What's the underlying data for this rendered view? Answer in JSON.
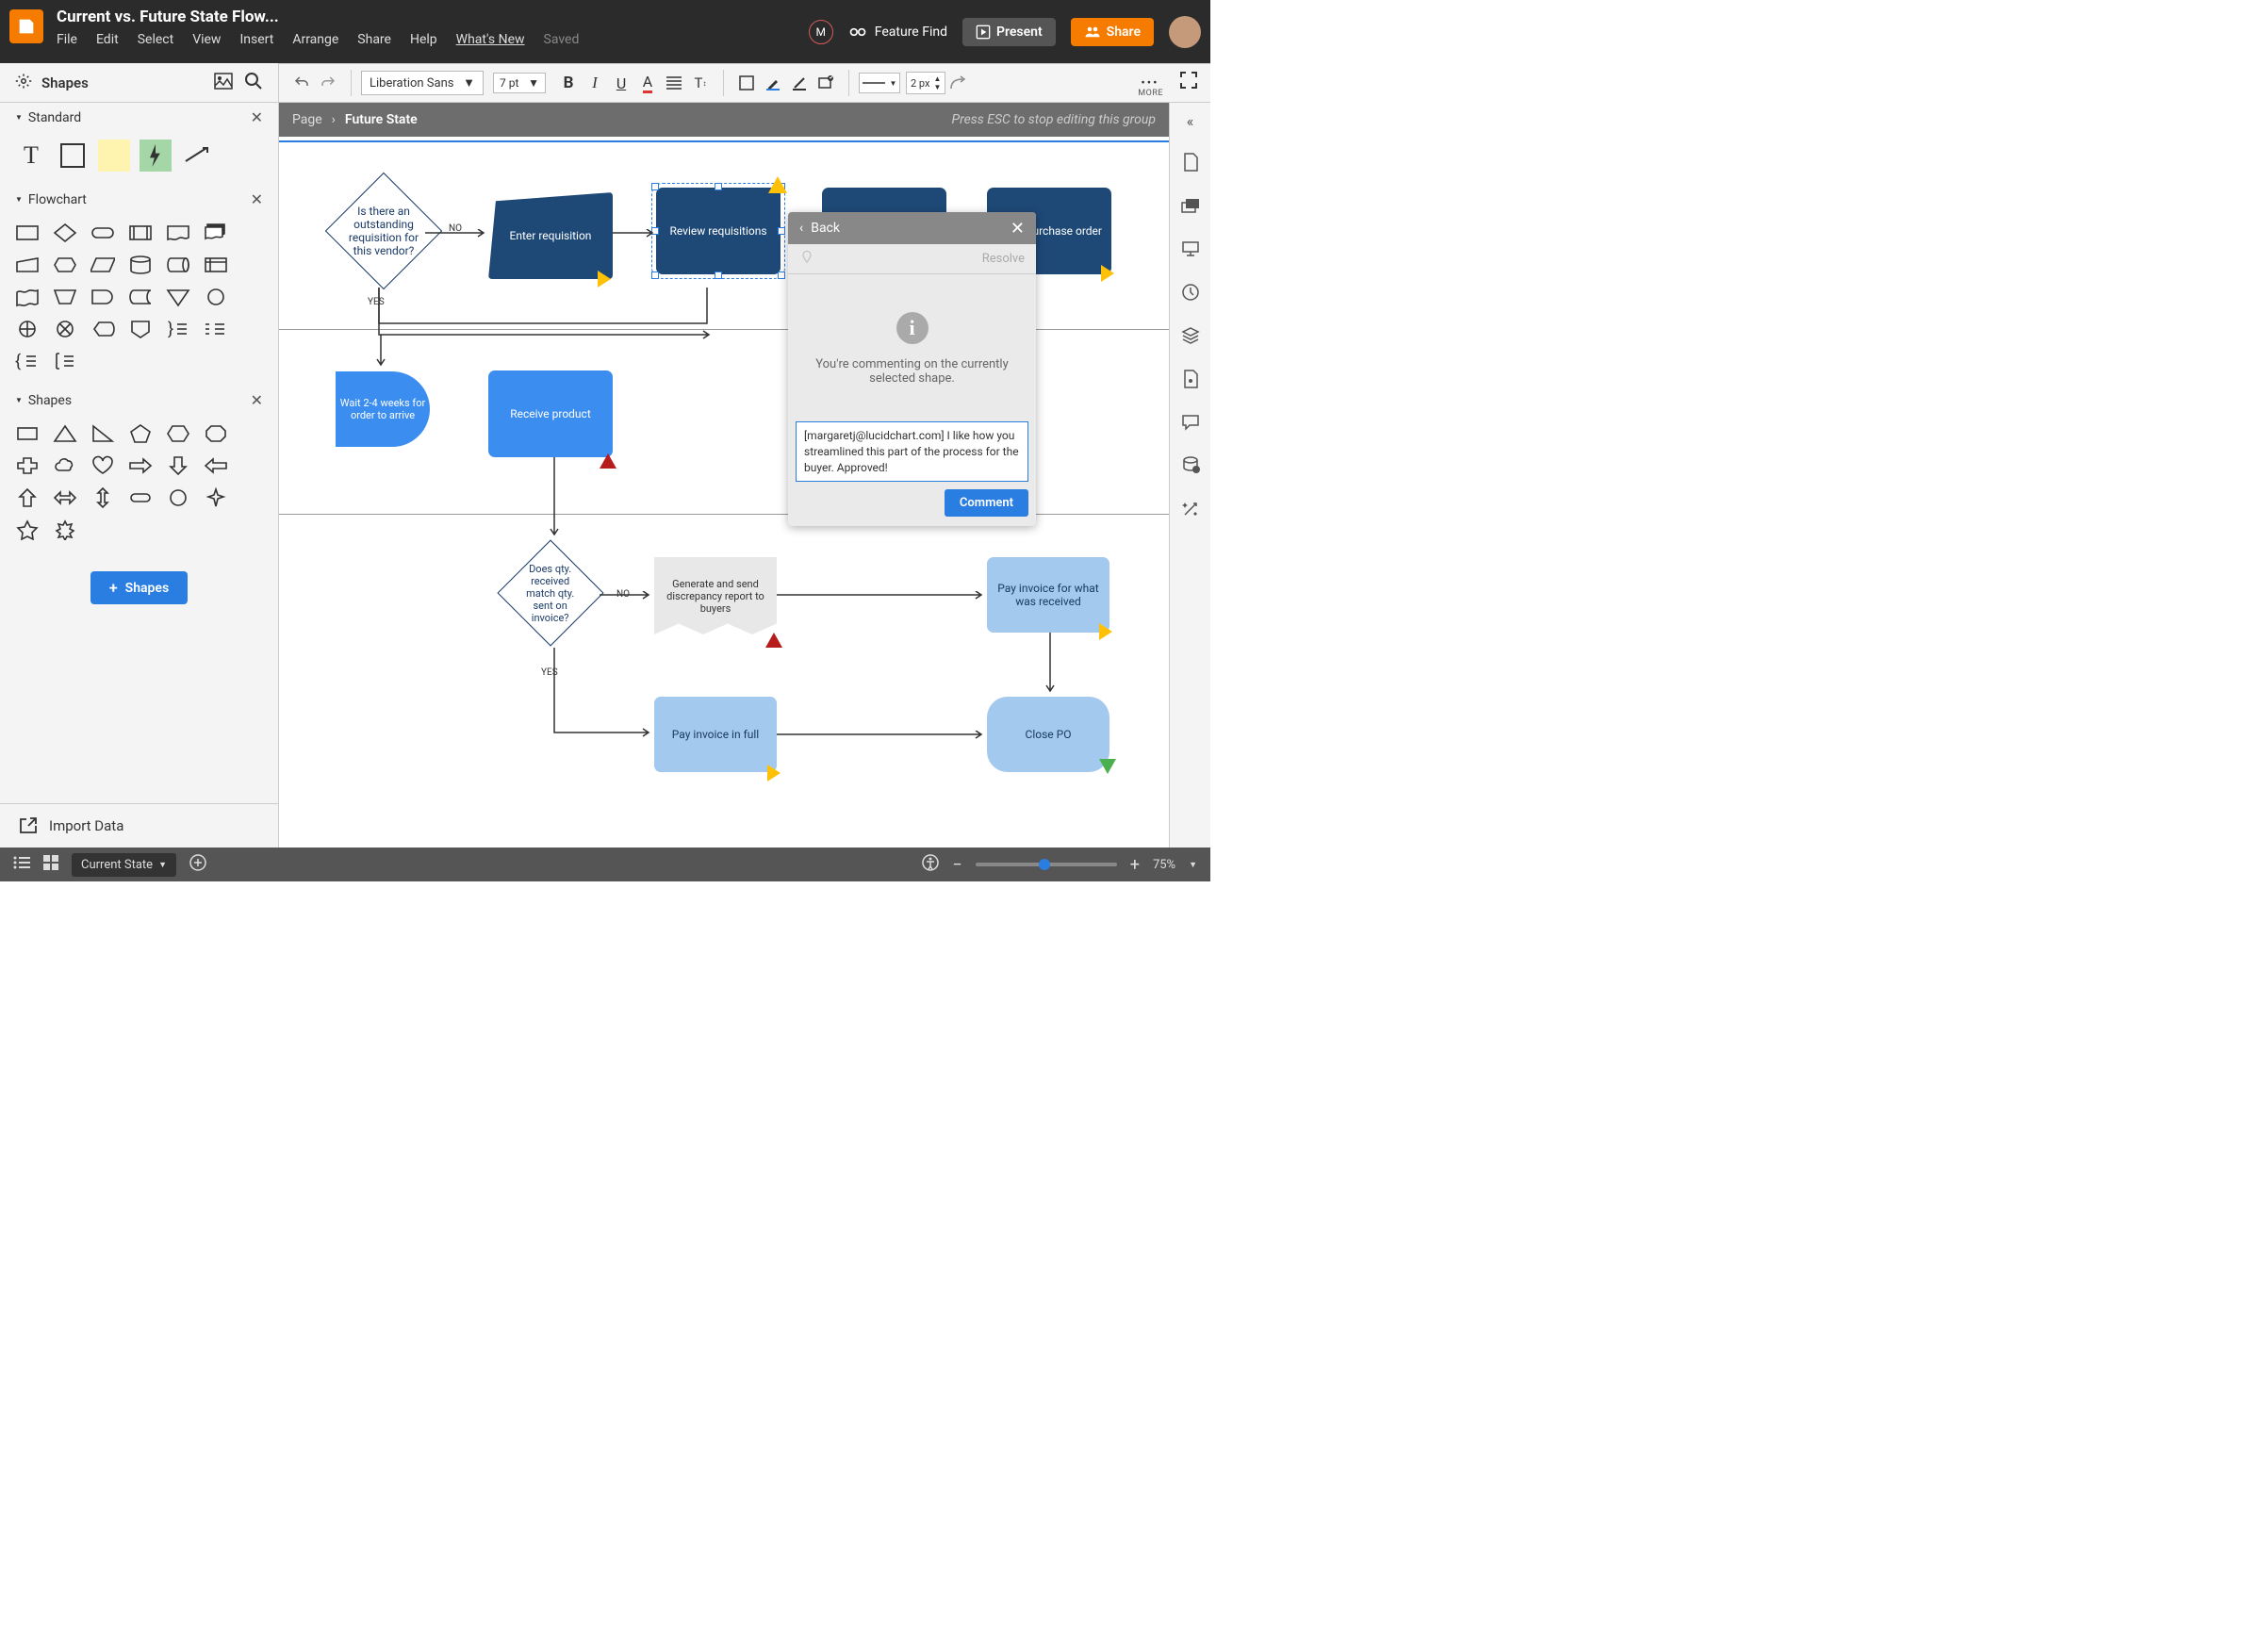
{
  "header": {
    "title": "Current vs. Future State Flow...",
    "menu": [
      "File",
      "Edit",
      "Select",
      "View",
      "Insert",
      "Arrange",
      "Share",
      "Help"
    ],
    "whatsnew": "What's New",
    "saved": "Saved",
    "avatar_letter": "M",
    "feature_find": "Feature Find",
    "present": "Present",
    "share": "Share"
  },
  "format": {
    "font": "Liberation Sans",
    "size": "7 pt",
    "line": "2 px",
    "more": "MORE"
  },
  "breadcrumb": {
    "page": "Page",
    "current": "Future State",
    "hint": "Press ESC to stop editing this group"
  },
  "sidebar": {
    "title": "Shapes",
    "groups": {
      "standard": "Standard",
      "flowchart": "Flowchart",
      "shapes": "Shapes"
    },
    "shapes_btn": "Shapes",
    "import": "Import Data"
  },
  "shapes": {
    "decision1": "Is there an outstanding requisition for this vendor?",
    "enter_req": "Enter requisition",
    "review_req": "Review requisitions",
    "purchase_order": "t purchase order",
    "wait": "Wait 2-4 weeks for order to arrive",
    "receive": "Receive product",
    "decision2": "Does qty. received match qty. sent on invoice?",
    "discrepancy": "Generate and send discrepancy report to buyers",
    "pay_received": "Pay invoice for what was received",
    "pay_full": "Pay invoice in full",
    "close": "Close PO",
    "no": "NO",
    "yes": "YES"
  },
  "comment": {
    "back": "Back",
    "resolve": "Resolve",
    "info": "You're commenting on the currently selected shape.",
    "text": "[margaretj@lucidchart.com] I like how you streamlined this part of the process for the buyer. Approved!",
    "button": "Comment"
  },
  "bottom": {
    "page": "Current State",
    "zoom": "75%"
  }
}
